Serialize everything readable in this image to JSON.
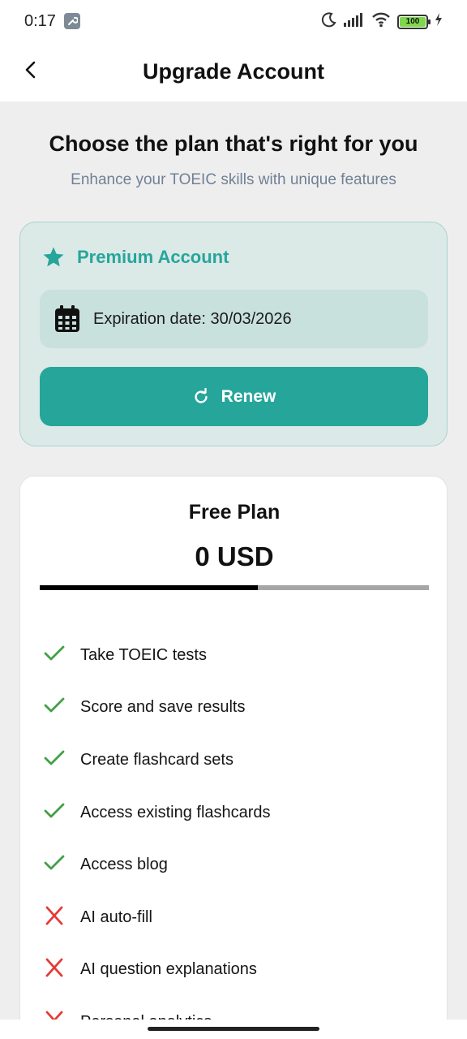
{
  "status_bar": {
    "time": "0:17",
    "battery": "100"
  },
  "header": {
    "title": "Upgrade Account"
  },
  "intro": {
    "headline": "Choose the plan that's right for you",
    "subheadline": "Enhance your TOEIC skills with unique features"
  },
  "premium": {
    "title": "Premium Account",
    "expiration": "Expiration date: 30/03/2026",
    "renew_label": "Renew"
  },
  "free_plan": {
    "name": "Free Plan",
    "price": "0 USD",
    "tab_indicator_fraction": 0.56,
    "features": [
      {
        "label": "Take TOEIC tests",
        "included": true
      },
      {
        "label": "Score and save results",
        "included": true
      },
      {
        "label": "Create flashcard sets",
        "included": true
      },
      {
        "label": "Access existing flashcards",
        "included": true
      },
      {
        "label": "Access blog",
        "included": true
      },
      {
        "label": "AI auto-fill",
        "included": false
      },
      {
        "label": "AI question explanations",
        "included": false
      },
      {
        "label": "Personal analytics",
        "included": false
      }
    ]
  },
  "colors": {
    "accent": "#26a69a",
    "check": "#43a047",
    "cross": "#e53935",
    "subtitle": "#6f8193"
  }
}
